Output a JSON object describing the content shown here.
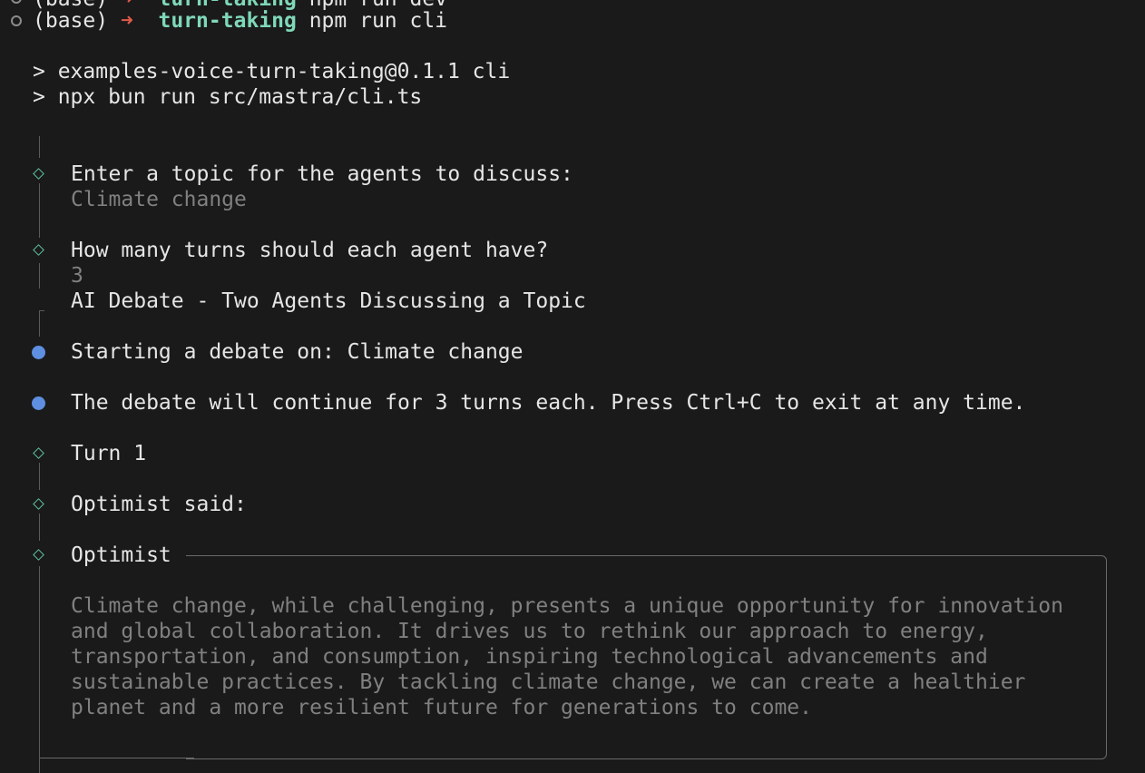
{
  "shell": {
    "prev_prompt_env": "(base)",
    "prev_prompt_arrow": "➜",
    "prev_prompt_dir": "turn-taking",
    "prev_prompt_cmd": "npm run dev",
    "prompt_env": "(base)",
    "prompt_arrow": "➜",
    "prompt_dir": "turn-taking",
    "prompt_cmd": "npm run cli"
  },
  "npm_output": {
    "line1": "> examples-voice-turn-taking@0.1.1 cli",
    "line2": "> npx bun run src/mastra/cli.ts"
  },
  "cli": {
    "q1_label": "Enter a topic for the agents to discuss:",
    "q1_answer": "Climate change",
    "q2_label": "How many turns should each agent have?",
    "q2_answer": "3",
    "intro_title": "AI Debate - Two Agents Discussing a Topic",
    "info1": "Starting a debate on: Climate change",
    "info2": "The debate will continue for 3 turns each. Press Ctrl+C to exit at any time.",
    "turn_label": "Turn 1",
    "said_label": "Optimist said:",
    "box_title": "Optimist",
    "box_lines": [
      "Climate change, while challenging, presents a unique opportunity for innovation",
      "and global collaboration. It drives us to rethink our approach to energy,",
      "transportation, and consumption, inspiring technological advancements and",
      "sustainable practices. By tackling climate change, we can create a healthier",
      "planet and a more resilient future for generations to come."
    ]
  },
  "colors": {
    "background": "#1a1a1a",
    "text": "#e6e6e6",
    "muted": "#808080",
    "accent_green": "#7fd8b8",
    "arrow_red": "#e05a4a",
    "diamond_green": "#5fc2a0",
    "info_blue": "#5e8fe0"
  },
  "icons": {
    "prompt_ring": "hollow-circle",
    "step_marker": "diamond-outline",
    "info_marker": "filled-circle"
  }
}
